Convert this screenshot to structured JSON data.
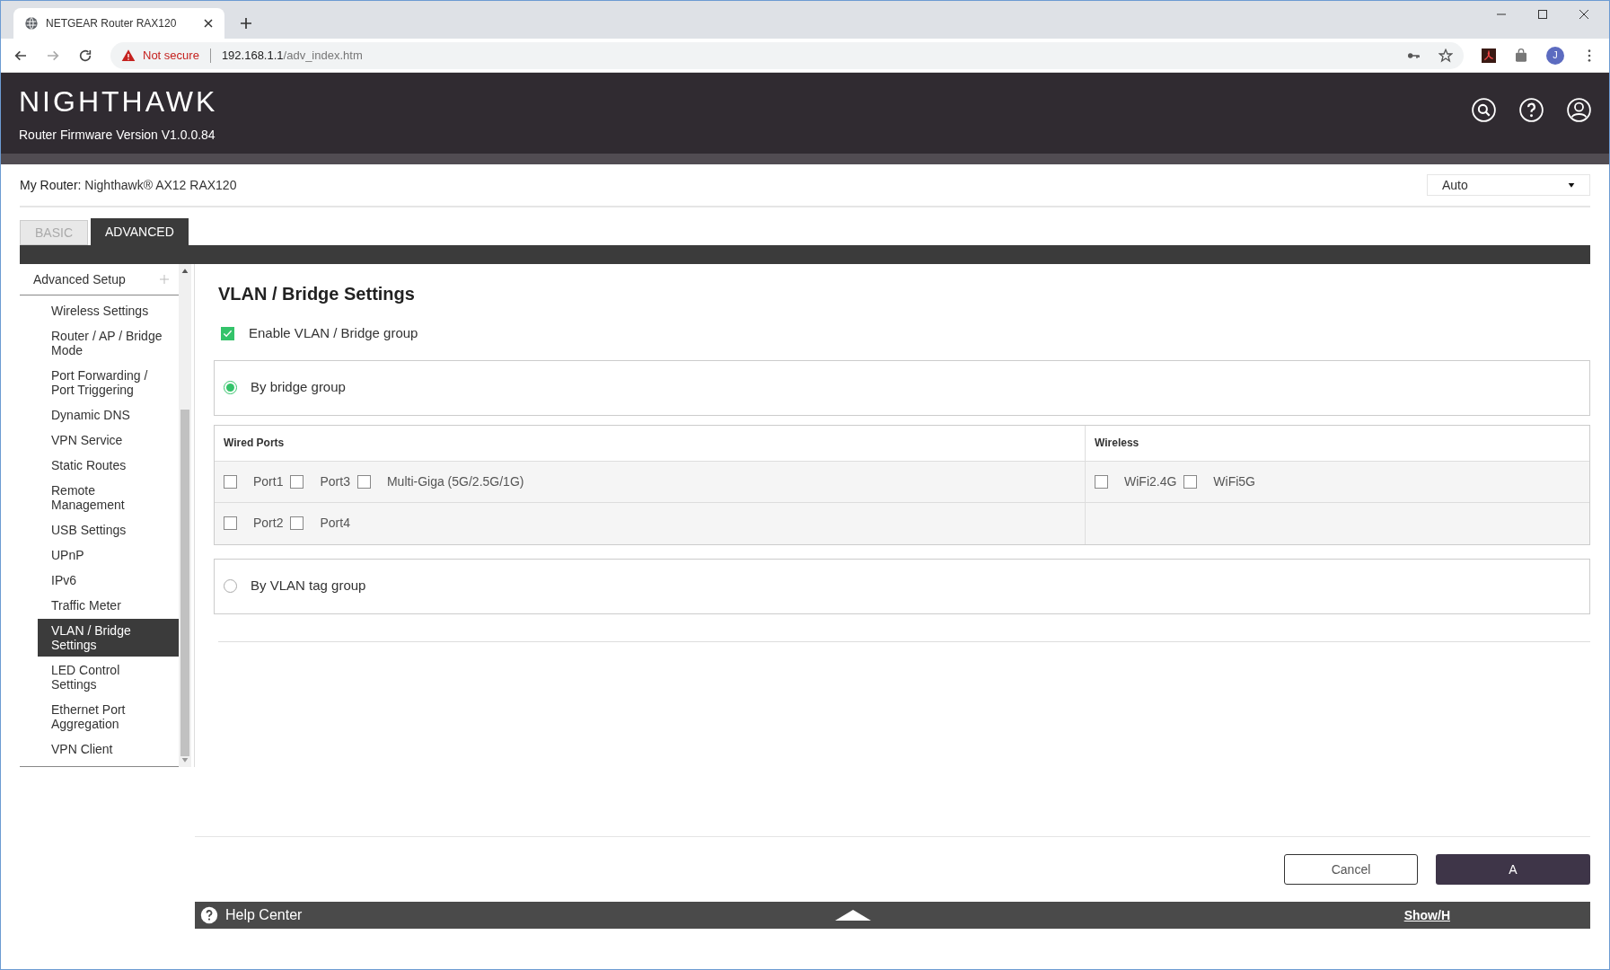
{
  "browser": {
    "tab_title": "NETGEAR Router RAX120",
    "security": "Not secure",
    "url_host": "192.168.1.1",
    "url_path": "/adv_index.htm",
    "profile_initial": "J"
  },
  "header": {
    "logo": "NIGHTHAWK",
    "firmware": "Router Firmware Version V1.0.0.84"
  },
  "router": {
    "label": "My Router:",
    "name": "Nighthawk® AX12 RAX120",
    "language": "Auto"
  },
  "tabs": [
    {
      "label": "BASIC",
      "selected": false
    },
    {
      "label": "ADVANCED",
      "selected": true
    }
  ],
  "sidebar": {
    "section": "Advanced Setup",
    "items": [
      {
        "label": "Wireless Settings",
        "selected": false
      },
      {
        "label": "Router / AP / Bridge Mode",
        "selected": false
      },
      {
        "label": "Port Forwarding / Port Triggering",
        "selected": false
      },
      {
        "label": "Dynamic DNS",
        "selected": false
      },
      {
        "label": "VPN Service",
        "selected": false
      },
      {
        "label": "Static Routes",
        "selected": false
      },
      {
        "label": "Remote Management",
        "selected": false
      },
      {
        "label": "USB Settings",
        "selected": false
      },
      {
        "label": "UPnP",
        "selected": false
      },
      {
        "label": "IPv6",
        "selected": false
      },
      {
        "label": "Traffic Meter",
        "selected": false
      },
      {
        "label": "VLAN / Bridge Settings",
        "selected": true
      },
      {
        "label": "LED Control Settings",
        "selected": false
      },
      {
        "label": "Ethernet Port Aggregation",
        "selected": false
      },
      {
        "label": "VPN Client",
        "selected": false
      }
    ]
  },
  "page": {
    "title": "VLAN / Bridge Settings",
    "enable": {
      "label": "Enable VLAN / Bridge group",
      "checked": true
    },
    "modes": [
      {
        "label": "By bridge group",
        "selected": true
      },
      {
        "label": "By VLAN tag group",
        "selected": false
      }
    ],
    "wired": {
      "heading": "Wired Ports",
      "rows": [
        [
          {
            "label": "Port1",
            "checked": false
          },
          {
            "label": "Port3",
            "checked": false
          },
          {
            "label": "Multi-Giga (5G/2.5G/1G)",
            "checked": false
          }
        ],
        [
          {
            "label": "Port2",
            "checked": false
          },
          {
            "label": "Port4",
            "checked": false
          }
        ]
      ]
    },
    "wireless": {
      "heading": "Wireless",
      "ports": [
        {
          "label": "WiFi2.4G",
          "checked": false
        },
        {
          "label": "WiFi5G",
          "checked": false
        }
      ]
    }
  },
  "buttons": {
    "cancel": "Cancel",
    "apply": "A"
  },
  "help": {
    "title": "Help Center",
    "toggle": "Show/H"
  }
}
